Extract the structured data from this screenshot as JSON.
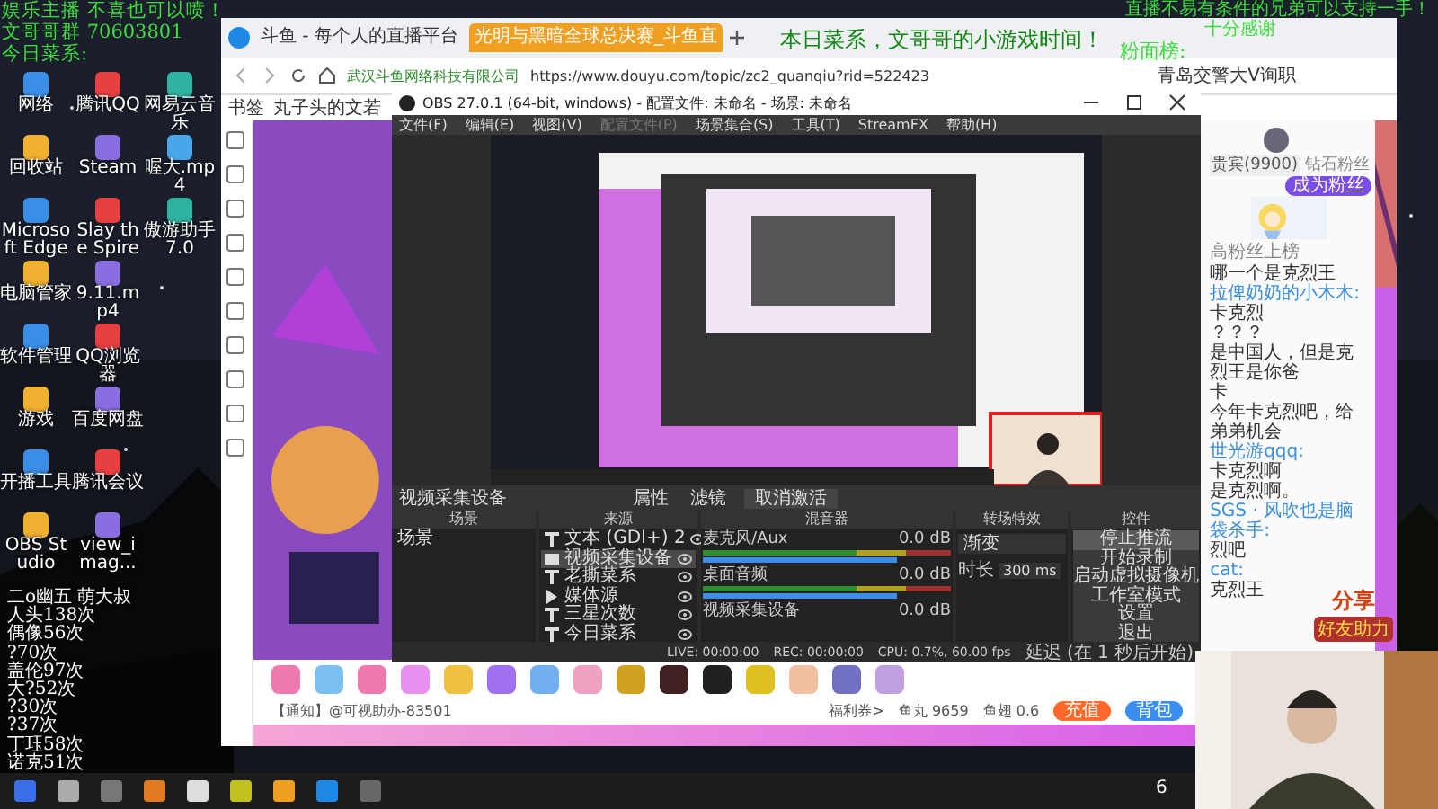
{
  "desktop": {
    "icon_rows": [
      [
        "网络",
        "腾讯QQ",
        "网易云音乐"
      ],
      [
        "回收站",
        "Steam",
        "喔大.mp4"
      ],
      [
        "Microsoft Edge",
        "Slay the Spire",
        "傲游助手7.0"
      ],
      [
        "电脑管家",
        "9.11.mp4"
      ],
      [
        "软件管理",
        "QQ浏览器"
      ],
      [
        "游戏",
        "百度网盘"
      ],
      [
        "开播工具",
        "腾讯会议"
      ],
      [
        "OBS Studio",
        "view_imag..."
      ]
    ]
  },
  "overlays": {
    "top_left": [
      "娱乐主播 不喜也可以喷！",
      "文哥哥群 70603801",
      "今日菜系:"
    ],
    "stats": [
      "二o幽五 萌大叔",
      "人头138次",
      "偶像56次",
      "?70次",
      "盖伦97次",
      "大?52次",
      "?30次",
      "?37次",
      "丁珏58次",
      "诺克51次"
    ],
    "top_right": [
      "直播不易有条件的兄弟可以支持一手！",
      "十分感谢"
    ],
    "center": "本日菜系，文哥哥的小游戏时间！",
    "board": "粉面榜:"
  },
  "browser": {
    "tabs": [
      {
        "label": "斗鱼 - 每个人的直播平台",
        "selected": false
      },
      {
        "label": "光明与黑暗全球总决赛_斗鱼直",
        "selected": true
      }
    ],
    "site": "武汉斗鱼网络科技有限公司",
    "url": "https://www.douyu.com/topic/zc2_quanqiu?rid=522423",
    "news": "青岛交警大V询职",
    "bookmarks": [
      "书签",
      "丸子头的文若"
    ],
    "notice": "【通知】@可视助办-83501",
    "coupons": "福利券>",
    "fish_balls": "鱼丸 9659",
    "fins": "鱼翅 0.6",
    "buttons": [
      "充值",
      "背包"
    ],
    "chat": {
      "tabs": [
        {
          "label": "贵宾(9900)",
          "selected": true
        },
        {
          "label": "钻石粉丝",
          "selected": false
        }
      ],
      "fan_button": "成为粉丝",
      "rank_hint": "高粉丝上榜",
      "messages": [
        {
          "text": "哪一个是克烈王"
        },
        {
          "user": "拉俾奶奶的小木木:",
          "text": "卡克烈"
        },
        {
          "text": "？？？"
        },
        {
          "text": "是中国人，但是克烈王是你爸"
        },
        {
          "text": "卡"
        },
        {
          "text": "今年卡克烈吧，给弟弟机会"
        },
        {
          "user": "世光游qqq:",
          "text": "卡克烈啊"
        },
        {
          "text": "是克烈啊。"
        },
        {
          "user": "SGS · 风吹也是脑袋杀手:"
        },
        {
          "text": "烈吧"
        },
        {
          "user": "cat:",
          "text": "克烈王"
        }
      ]
    },
    "share": [
      "分享",
      "好友助力"
    ]
  },
  "obs": {
    "title": "OBS 27.0.1 (64-bit, windows) - 配置文件: 未命名 - 场景: 未命名",
    "menu": [
      {
        "label": "文件(F)",
        "disabled": false
      },
      {
        "label": "编辑(E)",
        "disabled": false
      },
      {
        "label": "视图(V)",
        "disabled": false
      },
      {
        "label": "配置文件(P)",
        "disabled": true
      },
      {
        "label": "场景集合(S)",
        "disabled": false
      },
      {
        "label": "工具(T)",
        "disabled": false
      },
      {
        "label": "StreamFX",
        "disabled": false
      },
      {
        "label": "帮助(H)",
        "disabled": false
      }
    ],
    "source_bar": {
      "name": "视频采集设备",
      "buttons": [
        "属性",
        "滤镜"
      ],
      "deactivate": "取消激活"
    },
    "docks": [
      "场景",
      "来源",
      "混音器",
      "转场特效",
      "控件"
    ],
    "scenes": [
      "场景"
    ],
    "sources": [
      {
        "kind": "text",
        "name": "文本 (GDI+) 2",
        "selected": false
      },
      {
        "kind": "camera",
        "name": "视频采集设备",
        "selected": true
      },
      {
        "kind": "text",
        "name": "老撕菜系",
        "selected": false
      },
      {
        "kind": "media",
        "name": "媒体源",
        "selected": false
      },
      {
        "kind": "text",
        "name": "三星次数",
        "selected": false
      },
      {
        "kind": "text",
        "name": "今日菜系",
        "selected": false
      }
    ],
    "mixer": [
      {
        "name": "麦克风/Aux",
        "reading": "0.0 dB",
        "level": 1
      },
      {
        "name": "桌面音频",
        "reading": "0.0 dB",
        "level": 1
      },
      {
        "name": "视频采集设备",
        "reading": "0.0 dB"
      }
    ],
    "transition": {
      "name": "渐变",
      "duration_label": "时长",
      "duration": "300 ms"
    },
    "controls": [
      {
        "label": "停止推流",
        "selected": true
      },
      {
        "label": "开始录制",
        "selected": false
      },
      {
        "label": "启动虚拟摄像机",
        "selected": false
      },
      {
        "label": "工作室模式",
        "selected": false
      },
      {
        "label": "设置",
        "selected": false
      },
      {
        "label": "退出",
        "selected": false
      }
    ],
    "status": {
      "live": "LIVE: 00:00:00",
      "rec": "REC: 00:00:00",
      "perf": "CPU: 0.7%, 60.00 fps",
      "delay": "延迟 (在 1 秒后开始)"
    }
  },
  "taskbar": {
    "clock": "6"
  }
}
